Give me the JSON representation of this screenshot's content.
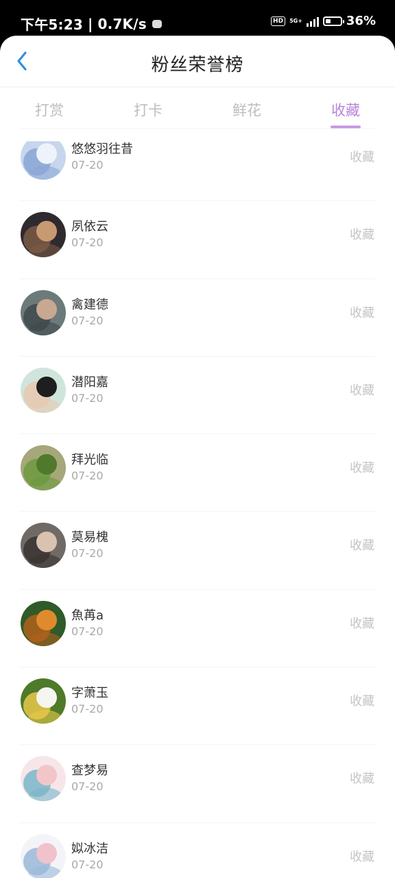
{
  "status_bar": {
    "time": "下午5:23",
    "network_speed": "0.7K/s",
    "hd": "HD",
    "network_type": "5G+",
    "battery_percent": "36%",
    "battery_level": 0.36
  },
  "header": {
    "back_icon": "chevron-left-icon",
    "title": "粉丝荣誉榜"
  },
  "tabs": [
    {
      "label": "打赏",
      "active": false
    },
    {
      "label": "打卡",
      "active": false
    },
    {
      "label": "鲜花",
      "active": false
    },
    {
      "label": "收藏",
      "active": true
    }
  ],
  "accent_color": "#b785d8",
  "list": [
    {
      "name": "悠悠羽往昔",
      "date": "07-20",
      "action": "收藏",
      "avatar": {
        "bg": "#c7d6ec",
        "fg": "#eef3fb",
        "accent": "#8aa6d6"
      }
    },
    {
      "name": "夙依云",
      "date": "07-20",
      "action": "收藏",
      "avatar": {
        "bg": "#2f2a2e",
        "fg": "#c79a72",
        "accent": "#7a5a44"
      }
    },
    {
      "name": "禽建德",
      "date": "07-20",
      "action": "收藏",
      "avatar": {
        "bg": "#6d7a7a",
        "fg": "#c9a892",
        "accent": "#3f4a4c"
      }
    },
    {
      "name": "潜阳嘉",
      "date": "07-20",
      "action": "收藏",
      "avatar": {
        "bg": "#cfe5dc",
        "fg": "#1e1e1e",
        "accent": "#e7c8b0"
      }
    },
    {
      "name": "拜光临",
      "date": "07-20",
      "action": "收藏",
      "avatar": {
        "bg": "#a6a77a",
        "fg": "#4f7a2e",
        "accent": "#6d9a3e"
      }
    },
    {
      "name": "莫易槐",
      "date": "07-20",
      "action": "收藏",
      "avatar": {
        "bg": "#6f6a66",
        "fg": "#d9c2b0",
        "accent": "#3a3431"
      }
    },
    {
      "name": "魚苒a",
      "date": "07-20",
      "action": "收藏",
      "avatar": {
        "bg": "#2f5a2a",
        "fg": "#e08a2e",
        "accent": "#b0601c"
      }
    },
    {
      "name": "字萧玉",
      "date": "07-20",
      "action": "收藏",
      "avatar": {
        "bg": "#4e7a2a",
        "fg": "#f6f6f0",
        "accent": "#e8c84a"
      }
    },
    {
      "name": "查梦易",
      "date": "07-20",
      "action": "收藏",
      "avatar": {
        "bg": "#f6e6ea",
        "fg": "#f2c6c8",
        "accent": "#7ab6c8"
      }
    },
    {
      "name": "姒冰洁",
      "date": "07-20",
      "action": "收藏",
      "avatar": {
        "bg": "#f4f4f8",
        "fg": "#f2c2cc",
        "accent": "#9ab8d8"
      }
    }
  ]
}
